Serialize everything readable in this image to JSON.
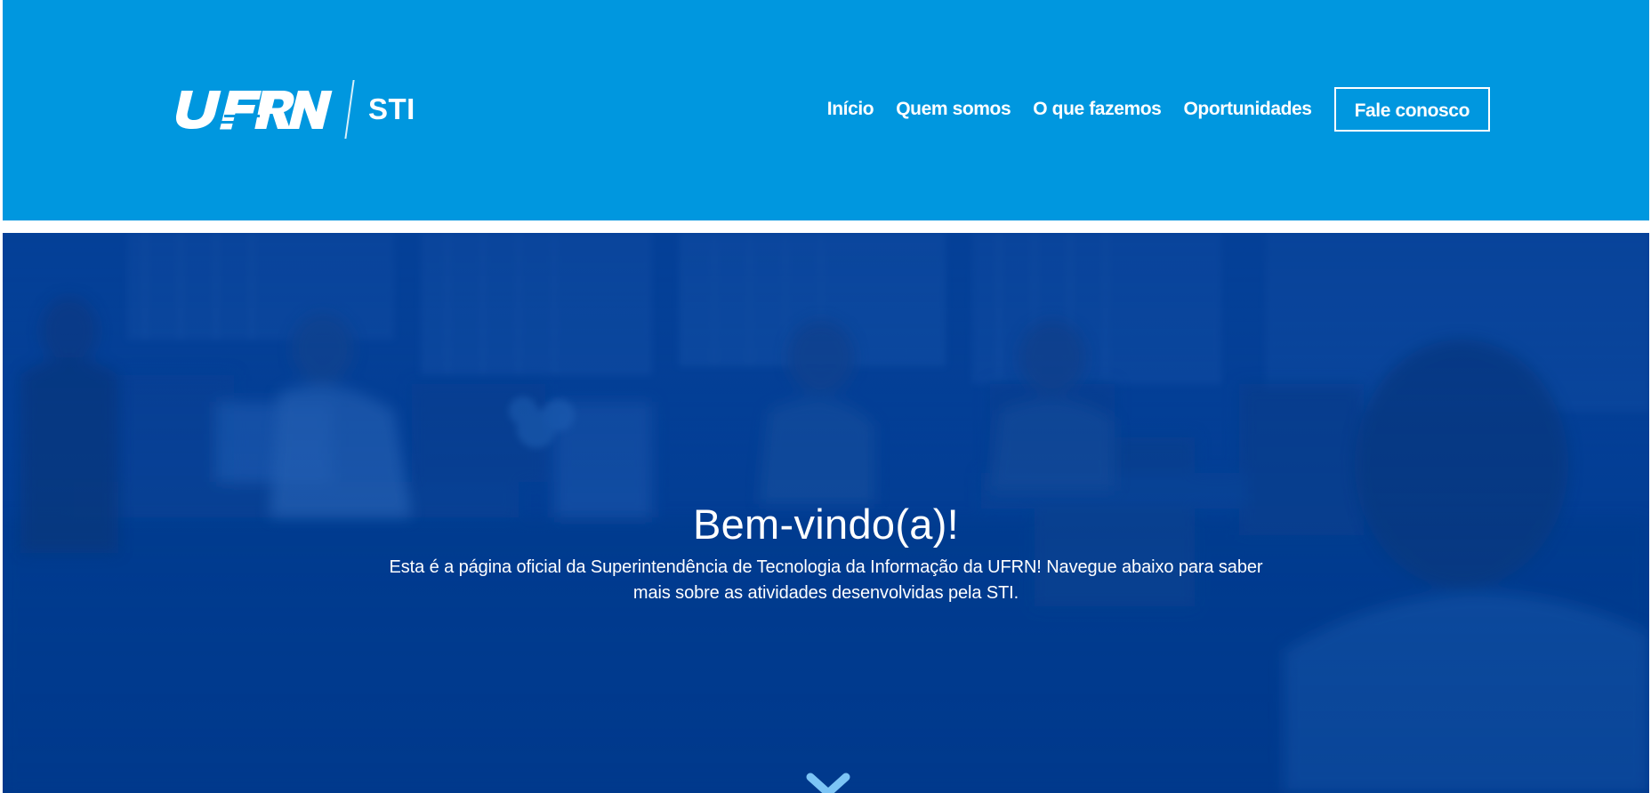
{
  "header": {
    "logo_text": "UFRN",
    "logo_subtext": "STI",
    "background_color": "#0097df"
  },
  "nav": {
    "items": [
      {
        "label": "Início"
      },
      {
        "label": "Quem somos"
      },
      {
        "label": "O que fazemos"
      },
      {
        "label": "Oportunidades"
      }
    ],
    "cta_label": "Fale conosco"
  },
  "hero": {
    "title": "Bem-vindo(a)!",
    "subtitle": "Esta é a página oficial da Superintendência de Tecnologia da Informação da UFRN! Navegue abaixo para saber mais sobre as atividades desenvolvidas pela STI.",
    "overlay_color": "#00428f",
    "scroll_icon": "chevron-down-icon",
    "scroll_icon_color": "#7cc4f5"
  }
}
